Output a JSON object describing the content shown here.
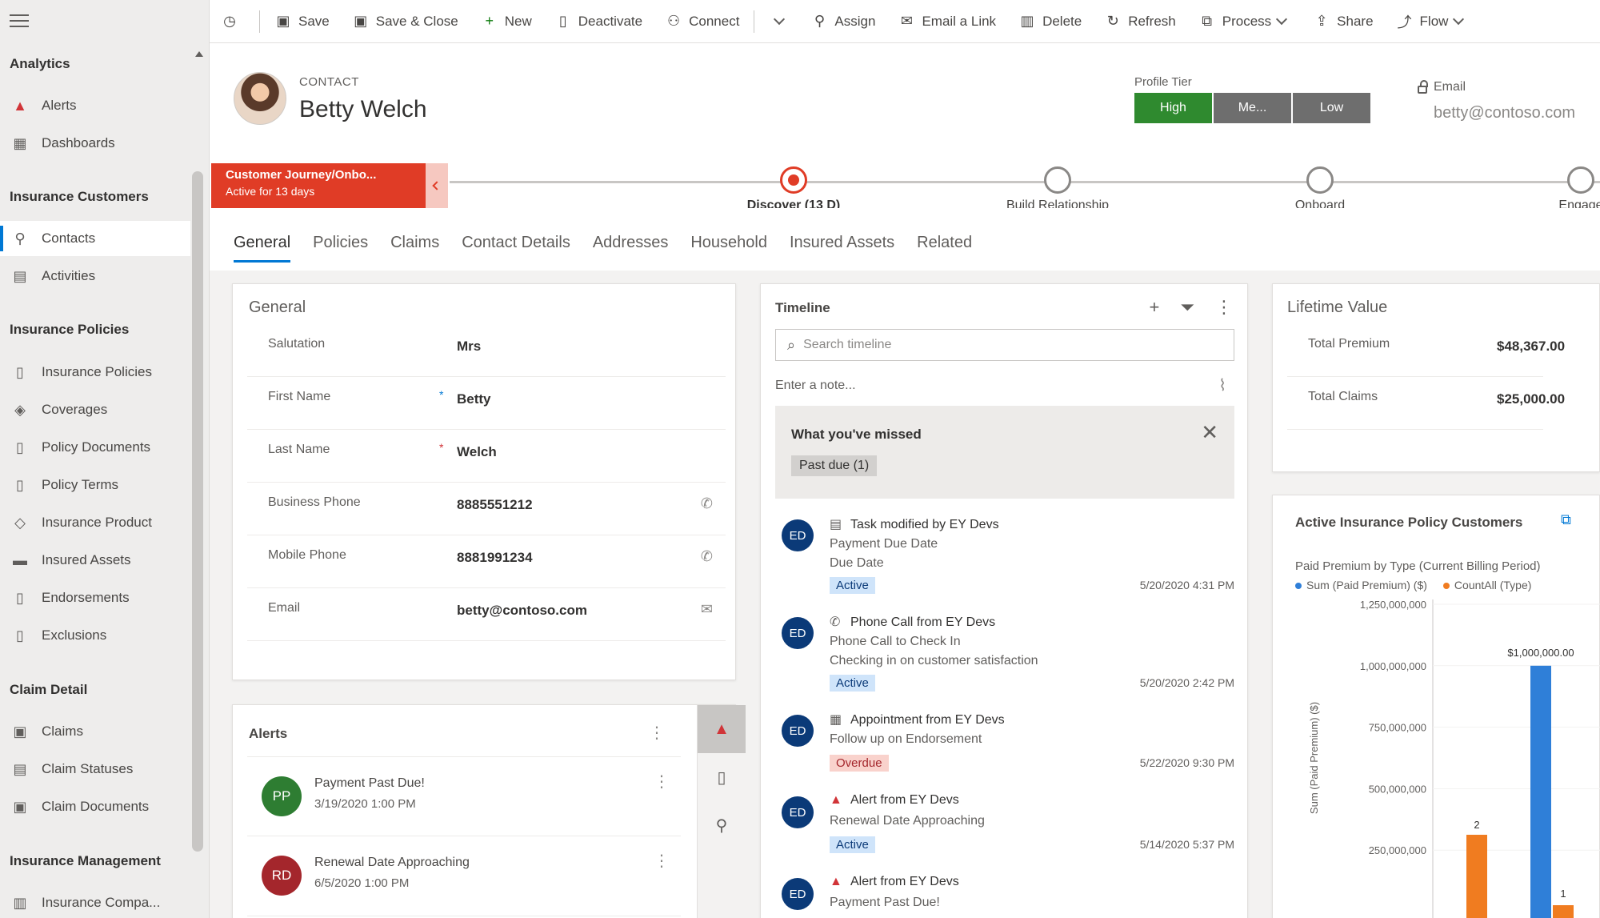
{
  "nav": {
    "sections": [
      {
        "title": "Analytics",
        "items": [
          {
            "label": "Alerts",
            "icon": "alert-icon"
          },
          {
            "label": "Dashboards",
            "icon": "dashboard-icon"
          }
        ]
      },
      {
        "title": "Insurance Customers",
        "items": [
          {
            "label": "Contacts",
            "icon": "person-icon",
            "active": true
          },
          {
            "label": "Activities",
            "icon": "clipboard-icon"
          }
        ]
      },
      {
        "title": "Insurance Policies",
        "items": [
          {
            "label": "Insurance Policies",
            "icon": "document-icon"
          },
          {
            "label": "Coverages",
            "icon": "shield-icon"
          },
          {
            "label": "Policy Documents",
            "icon": "document-icon"
          },
          {
            "label": "Policy Terms",
            "icon": "document-search-icon"
          },
          {
            "label": "Insurance Product",
            "icon": "tag-icon"
          },
          {
            "label": "Insured Assets",
            "icon": "car-icon"
          },
          {
            "label": "Endorsements",
            "icon": "document-edit-icon"
          },
          {
            "label": "Exclusions",
            "icon": "document-block-icon"
          }
        ]
      },
      {
        "title": "Claim Detail",
        "items": [
          {
            "label": "Claims",
            "icon": "claim-icon"
          },
          {
            "label": "Claim Statuses",
            "icon": "status-icon"
          },
          {
            "label": "Claim Documents",
            "icon": "claim-document-icon"
          }
        ]
      },
      {
        "title": "Insurance Management",
        "items": [
          {
            "label": "Insurance Compa...",
            "icon": "building-icon"
          }
        ]
      }
    ]
  },
  "cmdbar": {
    "save": "Save",
    "save_close": "Save & Close",
    "new": "New",
    "deactivate": "Deactivate",
    "connect": "Connect",
    "assign": "Assign",
    "email_link": "Email a Link",
    "delete": "Delete",
    "refresh": "Refresh",
    "process": "Process",
    "share": "Share",
    "flow": "Flow"
  },
  "header": {
    "entity_type": "CONTACT",
    "name": "Betty Welch",
    "profile_tier_label": "Profile Tier",
    "tiers": [
      "High",
      "Me...",
      "Low"
    ],
    "selected_tier": "High",
    "email_label": "Email",
    "email_value": "betty@contoso.com"
  },
  "bpf": {
    "active_title": "Customer Journey/Onbo...",
    "active_sub": "Active for 13 days",
    "stages": [
      "Discover  (13 D)",
      "Build Relationship",
      "Onboard",
      "Engage"
    ]
  },
  "tabs": [
    "General",
    "Policies",
    "Claims",
    "Contact Details",
    "Addresses",
    "Household",
    "Insured Assets",
    "Related"
  ],
  "general": {
    "title": "General",
    "fields": [
      {
        "label": "Salutation",
        "value": "Mrs",
        "req": "",
        "icon": ""
      },
      {
        "label": "First Name",
        "value": "Betty",
        "req": "*",
        "icon": ""
      },
      {
        "label": "Last Name",
        "value": "Welch",
        "req": "*",
        "icon": ""
      },
      {
        "label": "Business Phone",
        "value": "8885551212",
        "req": "",
        "icon": "phone-icon"
      },
      {
        "label": "Mobile Phone",
        "value": "8881991234",
        "req": "",
        "icon": "phone-icon"
      },
      {
        "label": "Email",
        "value": "betty@contoso.com",
        "req": "",
        "icon": "mail-icon"
      }
    ]
  },
  "alerts": {
    "title": "Alerts",
    "items": [
      {
        "initials": "PP",
        "color": "#2e7d32",
        "title": "Payment Past Due!",
        "date": "3/19/2020 1:00 PM"
      },
      {
        "initials": "RD",
        "color": "#a4262c",
        "title": "Renewal Date Approaching",
        "date": "6/5/2020 1:00 PM"
      }
    ]
  },
  "timeline": {
    "title": "Timeline",
    "search_placeholder": "Search timeline",
    "note_placeholder": "Enter a note...",
    "missed_title": "What you've missed",
    "missed_pill": "Past due (1)",
    "items": [
      {
        "icon": "task-icon",
        "title": "Task modified by EY Devs",
        "line2": "Payment Due Date",
        "line3": "Due Date",
        "status": "Active",
        "time": "5/20/2020 4:31 PM"
      },
      {
        "icon": "phone-call-icon",
        "title": "Phone Call from EY Devs",
        "line2": "Phone Call to Check In",
        "line3": "Checking in on customer satisfaction",
        "status": "Active",
        "time": "5/20/2020 2:42 PM"
      },
      {
        "icon": "calendar-icon",
        "title": "Appointment from EY Devs",
        "line2": "Follow up on Endorsement",
        "line3": "",
        "status": "Overdue",
        "time": "5/22/2020 9:30 PM"
      },
      {
        "icon": "alert-icon",
        "title": "Alert from EY Devs",
        "line2": "Renewal Date Approaching",
        "line3": "",
        "status": "Active",
        "time": "5/14/2020 5:37 PM"
      },
      {
        "icon": "alert-icon",
        "title": "Alert from EY Devs",
        "line2": "Payment Past Due!",
        "line3": "",
        "status": "",
        "time": ""
      }
    ],
    "avatar_initials": "ED"
  },
  "lifetime": {
    "title": "Lifetime Value",
    "rows": [
      {
        "label": "Total Premium",
        "value": "$48,367.00"
      },
      {
        "label": "Total Claims",
        "value": "$25,000.00"
      }
    ]
  },
  "chart_card": {
    "title": "Active Insurance Policy Customers",
    "subtitle": "Paid Premium by Type (Current Billing Period)",
    "legend": [
      {
        "label": "Sum (Paid Premium) ($)",
        "color": "#2f7fd8"
      },
      {
        "label": "CountAll (Type)",
        "color": "#f07c20"
      }
    ]
  },
  "chart_data": {
    "type": "bar",
    "ylabel": "Sum (Paid Premium) ($)",
    "ylim": [
      0,
      1250000000
    ],
    "yticks": [
      "1,250,000,000",
      "1,000,000,000",
      "750,000,000",
      "500,000,000",
      "250,000,000"
    ],
    "ytick_values": [
      1250000000,
      1000000000,
      750000000,
      500000000,
      250000000
    ],
    "series": [
      {
        "name": "Sum (Paid Premium) ($)",
        "values": [
          1000000000
        ],
        "labels": [
          "$1,000,000.00"
        ],
        "color": "#2f7fd8"
      },
      {
        "name": "CountAll (Type)",
        "values": [
          2,
          1
        ],
        "labels": [
          "2",
          "1"
        ],
        "color": "#f07c20"
      }
    ]
  }
}
